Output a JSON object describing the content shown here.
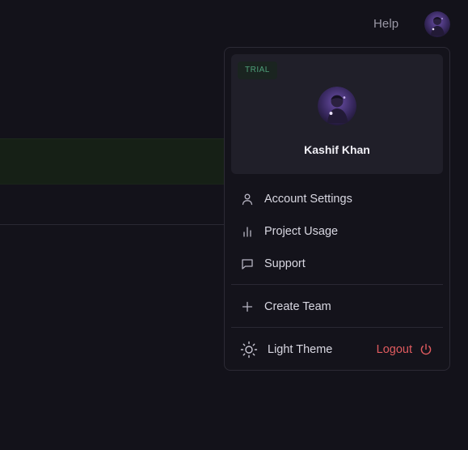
{
  "header": {
    "help_label": "Help",
    "avatar_icon": "user-avatar"
  },
  "colors": {
    "background": "#13121a",
    "menu_background": "#14131b",
    "card_background": "#201f29",
    "trial_text": "#4fa07a",
    "logout": "#e05b5f"
  },
  "profile": {
    "badge": "TRIAL",
    "name": "Kashif Khan",
    "avatar_icon": "user-avatar"
  },
  "menu": {
    "items": [
      {
        "label": "Account Settings",
        "icon": "user-icon"
      },
      {
        "label": "Project Usage",
        "icon": "bar-chart-icon"
      },
      {
        "label": "Support",
        "icon": "message-square-icon"
      }
    ],
    "create_team": {
      "label": "Create Team",
      "icon": "plus-icon"
    },
    "theme": {
      "label": "Light Theme",
      "icon": "sun-icon"
    },
    "logout": {
      "label": "Logout",
      "icon": "power-icon"
    }
  }
}
